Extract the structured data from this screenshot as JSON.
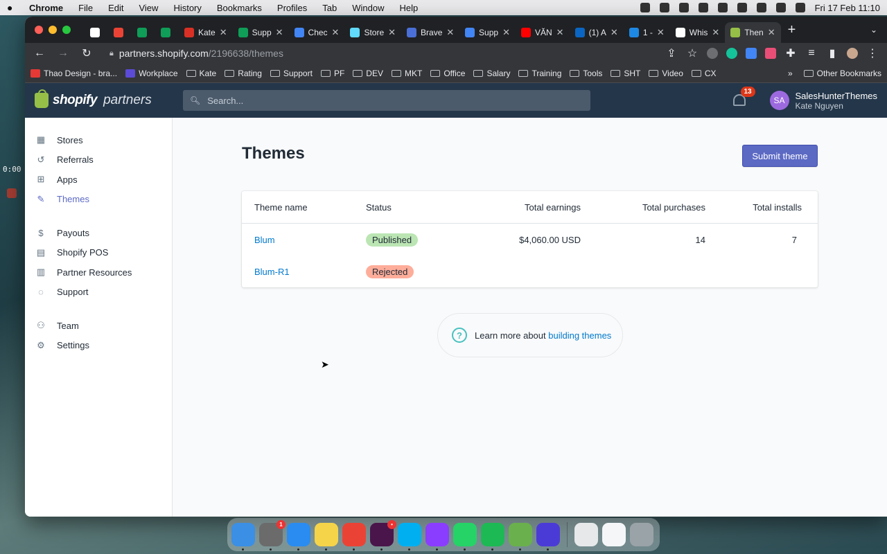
{
  "menubar": {
    "app_name": "Chrome",
    "menus": [
      "File",
      "Edit",
      "View",
      "History",
      "Bookmarks",
      "Profiles",
      "Tab",
      "Window",
      "Help"
    ],
    "clock": "Fri 17 Feb  11:10"
  },
  "desktop": {
    "timer": "0:00"
  },
  "tabs": [
    {
      "title": "",
      "color": "#ffffff"
    },
    {
      "title": "",
      "color": "#ea4335"
    },
    {
      "title": "",
      "color": "#0f9d58"
    },
    {
      "title": "",
      "color": "#0f9d58"
    },
    {
      "title": "Kate",
      "color": "#d93025"
    },
    {
      "title": "Supp",
      "color": "#0f9d58"
    },
    {
      "title": "Chec",
      "color": "#4285f4"
    },
    {
      "title": "Store",
      "color": "#61dafb"
    },
    {
      "title": "Brave",
      "color": "#4a6fd6"
    },
    {
      "title": "Supp",
      "color": "#4285f4"
    },
    {
      "title": "VĂN",
      "color": "#ff0000"
    },
    {
      "title": "(1) A",
      "color": "#0a66c2"
    },
    {
      "title": "1 -",
      "color": "#1e88e5"
    },
    {
      "title": "Whis",
      "color": "#ffffff"
    },
    {
      "title": "Then",
      "color": "#95bf47",
      "active": true
    }
  ],
  "address": {
    "domain": "partners.shopify.com",
    "path": "/2196638/themes"
  },
  "bookmarks": [
    {
      "label": "Thao Design - bra...",
      "type": "site"
    },
    {
      "label": "Workplace",
      "type": "site"
    },
    {
      "label": "Kate",
      "type": "folder"
    },
    {
      "label": "Rating",
      "type": "folder"
    },
    {
      "label": "Support",
      "type": "folder"
    },
    {
      "label": "PF",
      "type": "folder"
    },
    {
      "label": "DEV",
      "type": "folder"
    },
    {
      "label": "MKT",
      "type": "folder"
    },
    {
      "label": "Office",
      "type": "folder"
    },
    {
      "label": "Salary",
      "type": "folder"
    },
    {
      "label": "Training",
      "type": "folder"
    },
    {
      "label": "Tools",
      "type": "folder"
    },
    {
      "label": "SHT",
      "type": "folder"
    },
    {
      "label": "Video",
      "type": "folder"
    },
    {
      "label": "CX",
      "type": "folder"
    }
  ],
  "bookmarks_more": "»",
  "bookmarks_other": "Other Bookmarks",
  "header": {
    "brand_bold": "shopify",
    "brand_light": "partners",
    "search_placeholder": "Search...",
    "notifications": "13",
    "avatar_initials": "SA",
    "account_name": "SalesHunterThemes",
    "user_name": "Kate Nguyen"
  },
  "sidebar": {
    "groups": [
      [
        {
          "label": "Stores",
          "icon": "store-icon"
        },
        {
          "label": "Referrals",
          "icon": "referral-icon"
        },
        {
          "label": "Apps",
          "icon": "apps-icon"
        },
        {
          "label": "Themes",
          "icon": "themes-icon",
          "active": true
        }
      ],
      [
        {
          "label": "Payouts",
          "icon": "dollar-icon"
        },
        {
          "label": "Shopify POS",
          "icon": "pos-icon"
        },
        {
          "label": "Partner Resources",
          "icon": "book-icon"
        },
        {
          "label": "Support",
          "icon": "chat-icon"
        }
      ],
      [
        {
          "label": "Team",
          "icon": "team-icon"
        },
        {
          "label": "Settings",
          "icon": "gear-icon"
        }
      ]
    ]
  },
  "main": {
    "title": "Themes",
    "submit_label": "Submit theme",
    "table": {
      "headers": [
        "Theme name",
        "Status",
        "Total earnings",
        "Total purchases",
        "Total installs"
      ],
      "rows": [
        {
          "name": "Blum",
          "status": "Published",
          "status_color": "#bbe5b3",
          "earnings": "$4,060.00 USD",
          "purchases": "14",
          "installs": "7"
        },
        {
          "name": "Blum-R1",
          "status": "Rejected",
          "status_color": "#fead9a",
          "earnings": "",
          "purchases": "",
          "installs": ""
        }
      ]
    },
    "learn_text": "Learn more about",
    "learn_link": "building themes"
  },
  "dock": [
    {
      "name": "finder",
      "color": "#3b8fe5"
    },
    {
      "name": "system-preferences",
      "color": "#6b6b6b",
      "badge": "1"
    },
    {
      "name": "safari",
      "color": "#2a8cf0"
    },
    {
      "name": "notes",
      "color": "#f5d44a"
    },
    {
      "name": "chrome",
      "color": "#ea4335"
    },
    {
      "name": "slack",
      "color": "#4a154b",
      "badge": "•"
    },
    {
      "name": "skype",
      "color": "#00aff0"
    },
    {
      "name": "messenger",
      "color": "#8b3dff"
    },
    {
      "name": "whatsapp",
      "color": "#25d366"
    },
    {
      "name": "spotify",
      "color": "#1db954"
    },
    {
      "name": "vectorize",
      "color": "#6ab04c"
    },
    {
      "name": "workplace-chat",
      "color": "#4b3bd6"
    }
  ]
}
